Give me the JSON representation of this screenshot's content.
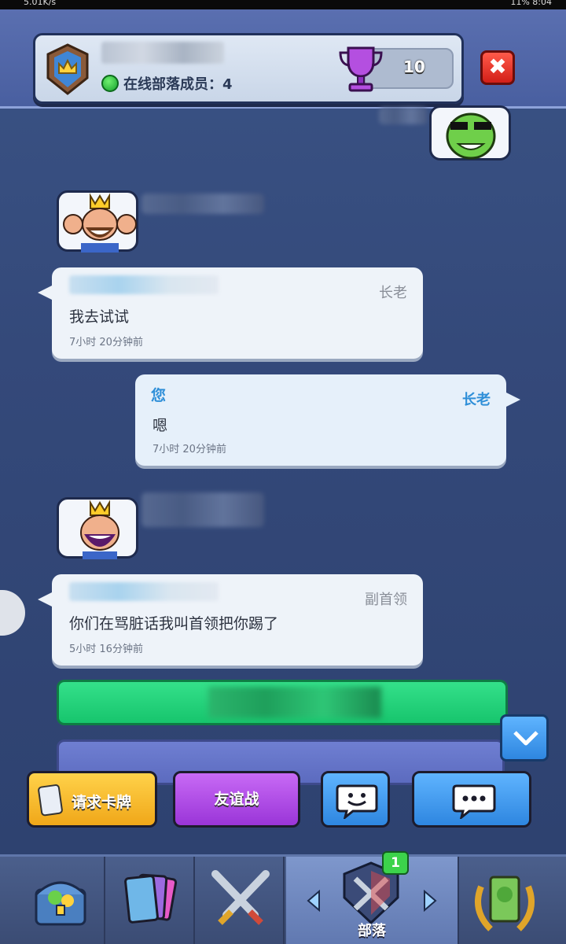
{
  "status_bar": {
    "net_speed": "5.01K/s",
    "battery": "11%",
    "time": "8:04"
  },
  "header": {
    "online_label": "在线部落成员：4",
    "trophy_count": "10",
    "close_label": "✖"
  },
  "messages": [
    {
      "role": "长老",
      "text": "我去试试",
      "time": "7小时 20分钟前"
    },
    {
      "sender": "您",
      "role": "长老",
      "text": "嗯",
      "time": "7小时 20分钟前"
    },
    {
      "role": "副首领",
      "text": "你们在骂脏话我叫首领把你踢了",
      "time": "5小时 16分钟前"
    }
  ],
  "actions": {
    "request_cards": "请求卡牌",
    "friendly_battle": "友谊战"
  },
  "nav": {
    "clan_label": "部落",
    "clan_badge": "1"
  },
  "colors": {
    "background": "#2f4676",
    "accent_green": "#17c56d",
    "accent_blue": "#2e86e0",
    "accent_purple": "#9a35d8",
    "accent_yellow": "#f0a719"
  }
}
